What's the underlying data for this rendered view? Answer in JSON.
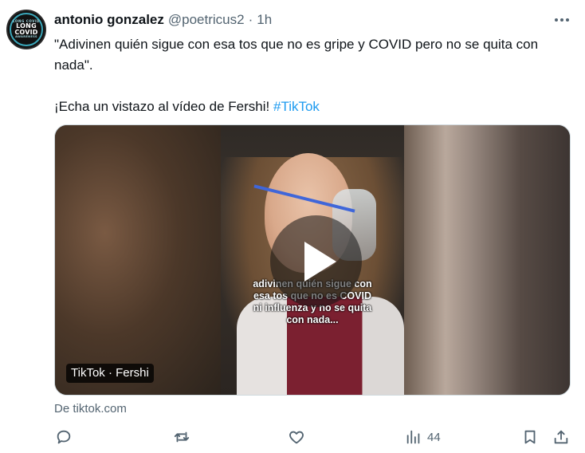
{
  "author": {
    "name": "antonio gonzalez",
    "handle": "@poetricus2",
    "separator": "·",
    "time": "1h",
    "avatar_text": [
      "LONG COVID",
      "LONG",
      "COVID",
      "AWARENESS"
    ]
  },
  "tweet": {
    "line1": "\"Adivinen quién sigue con esa tos que no es gripe y COVID pero no se quita con nada\".",
    "line2_prefix": "¡Echa un vistazo al vídeo de Fershi! ",
    "hashtag": "#TikTok"
  },
  "media": {
    "video_caption": "adivinen quién sigue con esa tos que no es COVID ni influenza y no se quita con nada...",
    "source_badge": "TikTok · Fershi"
  },
  "link_source": "De tiktok.com",
  "actions": {
    "reply_icon": "reply-icon",
    "retweet_icon": "retweet-icon",
    "like_icon": "heart-icon",
    "views_icon": "views-icon",
    "views_count": "44",
    "bookmark_icon": "bookmark-icon",
    "share_icon": "share-icon"
  },
  "colors": {
    "accent": "#1d9bf0",
    "text_primary": "#0f1419",
    "text_secondary": "#536471",
    "border": "#cfd9de"
  }
}
